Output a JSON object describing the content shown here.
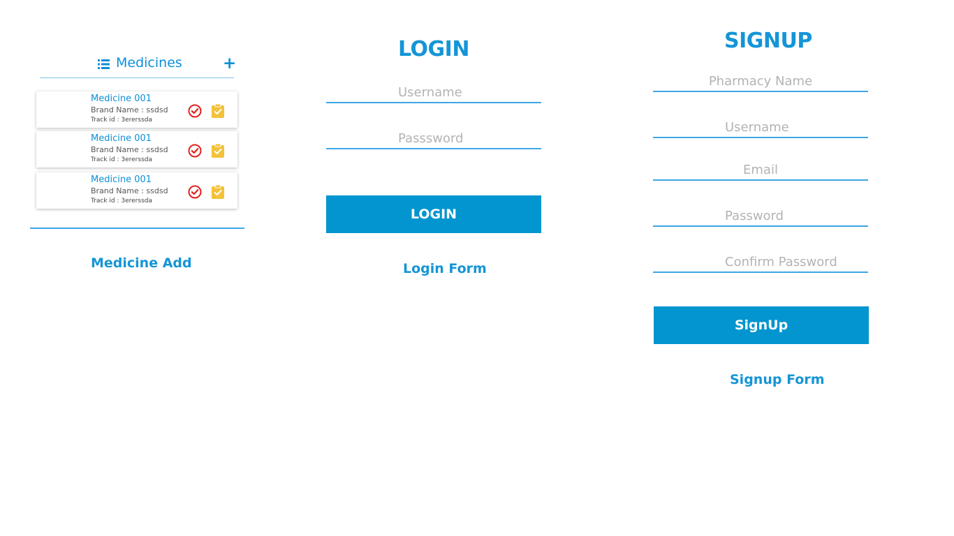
{
  "medicines": {
    "title": "Medicines",
    "list_icon": "list-icon",
    "add_icon": "plus-icon",
    "items": [
      {
        "name": "Medicine 001",
        "brand": "Brand Name : ssdsd",
        "track": "Track id : 3ererssda"
      },
      {
        "name": "Medicine 001",
        "brand": "Brand Name : ssdsd",
        "track": "Track id : 3ererssda"
      },
      {
        "name": "Medicine 001",
        "brand": "Brand Name : ssdsd",
        "track": "Track id : 3ererssda"
      }
    ],
    "caption": "Medicine Add"
  },
  "login": {
    "title": "LOGIN",
    "username_placeholder": "Username",
    "password_placeholder": "Passsword",
    "button_label": "LOGIN",
    "caption": "Login Form"
  },
  "signup": {
    "title": "SIGNUP",
    "pharmacy_placeholder": "Pharmacy Name",
    "username_placeholder": "Username",
    "email_placeholder": "Email",
    "password_placeholder": "Password",
    "confirm_placeholder": "Confirm Password",
    "button_label": "SignUp",
    "caption": "Signup Form"
  },
  "colors": {
    "accent": "#0c8fd6",
    "button": "#0395cf",
    "check_red": "#e0211b",
    "clipboard_yellow": "#f3c13a"
  }
}
